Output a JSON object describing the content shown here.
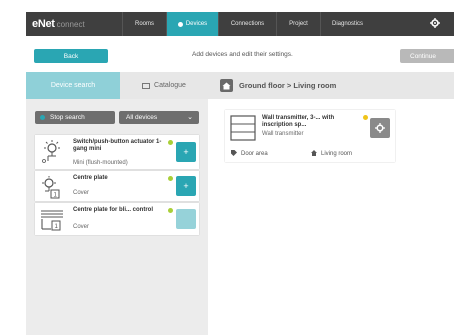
{
  "app": {
    "logo_main": "eNet",
    "logo_sub": "connect"
  },
  "nav": {
    "items": [
      {
        "label": "Rooms",
        "active": false
      },
      {
        "label": "Devices",
        "active": true
      },
      {
        "label": "Connections",
        "active": false
      },
      {
        "label": "Project",
        "active": false
      },
      {
        "label": "Diagnostics",
        "active": false
      }
    ],
    "settings_icon": "gear-icon"
  },
  "actions": {
    "back_label": "Back",
    "instruction": "Add devices and edit their settings.",
    "continue_label": "Continue"
  },
  "tabs": {
    "device_search": "Device search",
    "catalogue": "Catalogue",
    "room_path": "Ground floor > Living room"
  },
  "search": {
    "stop_label": "Stop search",
    "filter_value": "All devices"
  },
  "devices": [
    {
      "title": "Switch/push-button actuator 1-gang mini",
      "subtitle": "Mini (flush-mounted)",
      "icon": "light-actuator-icon",
      "add_icon": "plus-icon",
      "badge": "1"
    },
    {
      "title": "Centre plate",
      "subtitle": "Cover",
      "icon": "light-cover-icon",
      "add_icon": "plus-icon",
      "badge": "1"
    },
    {
      "title": "Centre plate for bli... control",
      "subtitle": "Cover",
      "icon": "blind-cover-icon",
      "add_icon": "",
      "badge": "1"
    }
  ],
  "room_devices": [
    {
      "title": "Wall transmitter, 3-... with inscription sp...",
      "subtitle": "Wall transmitter",
      "icon": "wall-transmitter-icon",
      "location": "Door area",
      "room": "Living room"
    }
  ],
  "colors": {
    "accent": "#2aa6b3",
    "accent_light": "#8fd0d8",
    "topbar": "#3f3f3f",
    "status_green": "#a9cf38",
    "status_yellow": "#f0c419"
  }
}
